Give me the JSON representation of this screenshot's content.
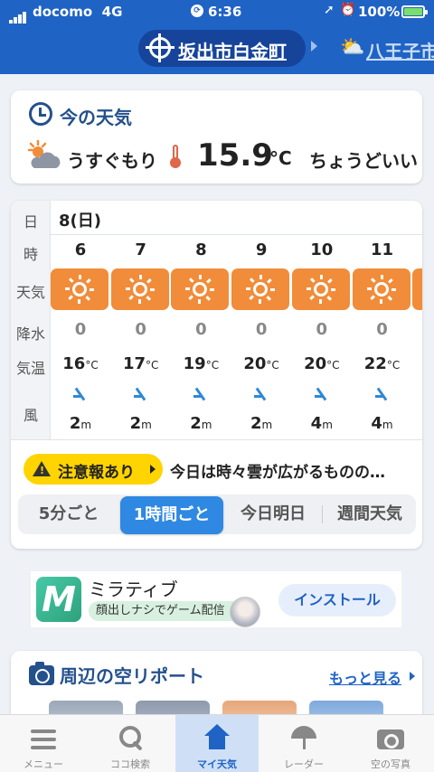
{
  "status_bar": {
    "carrier": "docomo",
    "network": "4G",
    "time": "6:36",
    "battery": "100%"
  },
  "location": {
    "current": "坂出市白金町",
    "next": "八王子市",
    "next_icon": "partly-cloudy-icon"
  },
  "now": {
    "title": "今の天気",
    "condition": "うすぐもり",
    "temperature": "15.9",
    "unit": "°C",
    "feel": "ちょうどいい"
  },
  "hourly": {
    "labels": {
      "day": "日",
      "hour": "時",
      "weather": "天気",
      "precip": "降水",
      "temp": "気温",
      "wind": "風"
    },
    "day": "8(日)",
    "temp_unit": "°C",
    "wind_unit": "m",
    "hours": [
      {
        "hour": "6",
        "weather_icon": "sunny-icon",
        "precip": "0",
        "temp": "16",
        "wind": "2"
      },
      {
        "hour": "7",
        "weather_icon": "sunny-icon",
        "precip": "0",
        "temp": "17",
        "wind": "2"
      },
      {
        "hour": "8",
        "weather_icon": "sunny-icon",
        "precip": "0",
        "temp": "19",
        "wind": "2"
      },
      {
        "hour": "9",
        "weather_icon": "sunny-icon",
        "precip": "0",
        "temp": "20",
        "wind": "2"
      },
      {
        "hour": "10",
        "weather_icon": "sunny-icon",
        "precip": "0",
        "temp": "20",
        "wind": "4"
      },
      {
        "hour": "11",
        "weather_icon": "sunny-icon",
        "precip": "0",
        "temp": "22",
        "wind": "4"
      }
    ]
  },
  "warning": {
    "label": "注意報あり",
    "text": "今日は時々雲が広がるものの…"
  },
  "tabs": [
    "5分ごと",
    "1時間ごと",
    "今日明日",
    "週間天気"
  ],
  "active_tab": "1時間ごと",
  "ad": {
    "logo_letter": "M",
    "title": "ミラティブ",
    "subtitle": "顔出しナシでゲーム配信",
    "button": "インストール"
  },
  "sky_report": {
    "title": "周辺の空リポート",
    "more": "もっと見る"
  },
  "nav": [
    {
      "label": "メニュー",
      "icon": "menu-icon"
    },
    {
      "label": "ココ検索",
      "icon": "search-icon"
    },
    {
      "label": "マイ天気",
      "icon": "home-icon"
    },
    {
      "label": "レーダー",
      "icon": "umbrella-icon"
    },
    {
      "label": "空の写真",
      "icon": "camera-icon"
    }
  ],
  "active_nav": "マイ天気",
  "colors": {
    "header": "#1f63c5",
    "sunny_box": "#f18c3a",
    "warning": "#ffd400",
    "active_tab": "#2f88e2",
    "title_text": "#24518c"
  }
}
